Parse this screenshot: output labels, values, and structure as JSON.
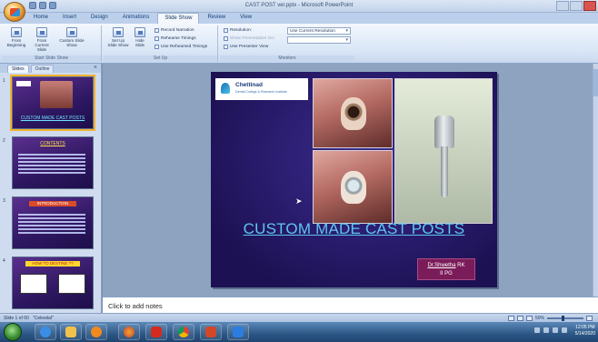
{
  "window": {
    "title": "CAST POST ver.pptx - Microsoft PowerPoint"
  },
  "ribbon_tabs": [
    {
      "label": "Home",
      "active": false
    },
    {
      "label": "Insert",
      "active": false
    },
    {
      "label": "Design",
      "active": false
    },
    {
      "label": "Animations",
      "active": false
    },
    {
      "label": "Slide Show",
      "active": true
    },
    {
      "label": "Review",
      "active": false
    },
    {
      "label": "View",
      "active": false
    }
  ],
  "ribbon": {
    "start_group": {
      "label": "Start Slide Show",
      "from_beginning": "From Beginning",
      "from_current": "From Current Slide",
      "custom": "Custom Slide Show"
    },
    "setup_group": {
      "label": "Set Up",
      "setup_show": "Set Up Slide Show",
      "hide_slide": "Hide Slide",
      "record_narration": "Record Narration",
      "rehearse_timings": "Rehearse Timings",
      "use_rehearsed": "Use Rehearsed Timings"
    },
    "monitors_group": {
      "label": "Monitors",
      "resolution_label": "Resolution:",
      "resolution_value": "Use Current Resolution",
      "show_on_label": "Show Presentation On:",
      "presenter_view": "Use Presenter View"
    }
  },
  "slides_panel": {
    "tab_slides": "Slides",
    "tab_outline": "Outline",
    "close_glyph": "×",
    "thumbnails": [
      {
        "number": "1",
        "title": "CUSTOM MADE CAST POSTS"
      },
      {
        "number": "2",
        "title": "CONTENTS"
      },
      {
        "number": "3",
        "title": "INTRODUCTION"
      },
      {
        "number": "4",
        "title": "HOW TO DESTINE ??"
      }
    ]
  },
  "slide": {
    "logo_name": "Chettinad",
    "logo_tagline": "Dental College & Research Institute",
    "title": "CUSTOM MADE CAST POSTS",
    "author": "Dr.Shwetha",
    "author_suffix": " RK",
    "role": "II PG"
  },
  "notes": {
    "placeholder": "Click to add notes"
  },
  "status_bar": {
    "slide_info": "Slide 1 of 60",
    "theme": "\"Celestial\"",
    "zoom": "50%"
  },
  "taskbar": {
    "time": "12:05 PM",
    "date": "5/14/2020"
  },
  "icons": {
    "office_button": "office-logo-icon",
    "start": "windows-start-icon"
  },
  "colors": {
    "slide_title": "#5ec6f0",
    "author_box": "#7b1c5a",
    "ribbon_bg": "#d9e6f6"
  }
}
